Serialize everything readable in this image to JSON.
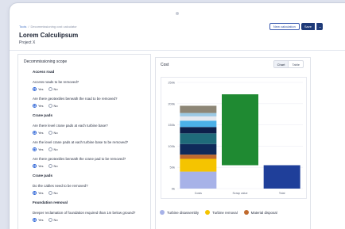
{
  "breadcrumb": [
    "Tools",
    "/",
    "Decommissioning cost calculator"
  ],
  "header": {
    "title": "Lorem Calculipsum",
    "subtitle": "Project X",
    "new_calc_label": "New calculation",
    "save_label": "Save",
    "caret": "⌄"
  },
  "scope": {
    "title": "Decommissioning scope",
    "items": [
      {
        "type": "section",
        "text": "Access road"
      },
      {
        "type": "question",
        "text": "Access roads to be removed?",
        "answer": "Yes"
      },
      {
        "type": "question",
        "text": "Are there geotextiles beneath the road to be removed?",
        "answer": "Yes"
      },
      {
        "type": "section",
        "text": "Crane pads"
      },
      {
        "type": "question",
        "text": "Are there level crane pads at each turbine base?",
        "answer": "Yes"
      },
      {
        "type": "question",
        "text": "Are the level crane pads at each turbine base to be removed?",
        "answer": "Yes"
      },
      {
        "type": "question",
        "text": "Are there geotextiles beneath the crane pad to be removed?",
        "answer": "Yes"
      },
      {
        "type": "section",
        "text": "Crane pads"
      },
      {
        "type": "question",
        "text": "Do the cables need to be removed?",
        "answer": "Yes"
      },
      {
        "type": "section",
        "text": "Foundation removal"
      },
      {
        "type": "question",
        "text": "Deeper reclamation of foundation required than 1m below ground?",
        "answer": "Yes"
      }
    ],
    "yes_label": "Yes",
    "no_label": "No"
  },
  "cost": {
    "title": "Cost",
    "tab_chart": "Chart",
    "tab_table": "Table"
  },
  "chart_data": {
    "type": "bar",
    "categories": [
      "Costs",
      "Scrap value",
      "Total"
    ],
    "y_ticks": [
      "0k",
      "50k",
      "100k",
      "150k",
      "200k",
      "250k"
    ],
    "ylim": [
      0,
      250
    ],
    "costs_segments": [
      {
        "value": 40,
        "color": "#a7b2e8"
      },
      {
        "value": 30,
        "color": "#f5c400"
      },
      {
        "value": 10,
        "color": "#c06a2e"
      },
      {
        "value": 25,
        "color": "#0f2a5a"
      },
      {
        "value": 25,
        "color": "#1f6b7a"
      },
      {
        "value": 15,
        "color": "#0d1f4a"
      },
      {
        "value": 15,
        "color": "#4bb0e8"
      },
      {
        "value": 10,
        "color": "#e6e9f0"
      },
      {
        "value": 8,
        "color": "#9bc9e4"
      },
      {
        "value": 17,
        "color": "#8d8676"
      }
    ],
    "scrap_range": [
      55,
      222
    ],
    "scrap_color": "#1f8a32",
    "total_value": 55,
    "total_color": "#1f3f9a",
    "legend": [
      {
        "label": "Turbine disassembly",
        "color": "#a7b2e8"
      },
      {
        "label": "Turbine removal",
        "color": "#f5c400"
      },
      {
        "label": "Material disposal",
        "color": "#c06a2e"
      }
    ]
  }
}
